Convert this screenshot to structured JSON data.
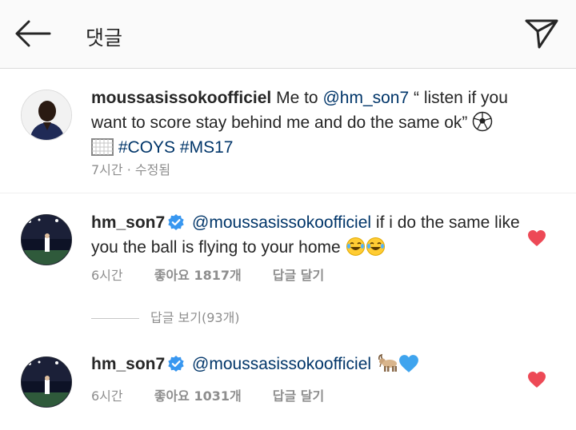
{
  "header": {
    "title": "댓글",
    "back_icon": "arrow-left-icon",
    "share_icon": "paper-plane-icon"
  },
  "caption": {
    "username": "moussasissokoofficiel",
    "text_before": "Me to ",
    "mention": "@hm_son7",
    "text_after": " “ listen if you want to score stay behind me and do the same ok” ",
    "emoji_1": "soccer-ball-icon",
    "emoji_2": "goal-net-icon",
    "hashtags": [
      "#COYS",
      "#MS17"
    ],
    "time": "7시간 · 수정됨"
  },
  "comments": [
    {
      "username": "hm_son7",
      "verified": true,
      "mention": "@moussasissokoofficiel",
      "text": " if i do the same like you the ball is flying to your home ",
      "emojis": [
        "tears-of-joy-icon",
        "tears-of-joy-icon"
      ],
      "time": "6시간",
      "likes_label": "좋아요 1817개",
      "reply_label": "답글 달기",
      "liked": true
    },
    {
      "username": "hm_son7",
      "verified": true,
      "mention": "@moussasissokoofficiel",
      "text": " ",
      "emojis": [
        "goat-icon",
        "blue-heart-icon"
      ],
      "time": "6시간",
      "likes_label": "좋아요 1031개",
      "reply_label": "답글 달기",
      "liked": true
    }
  ],
  "view_replies": "답글 보기(93개)",
  "colors": {
    "mention": "#003569",
    "heart": "#ed4956",
    "verified": "#3897f0",
    "meta": "#8e8e8e"
  }
}
